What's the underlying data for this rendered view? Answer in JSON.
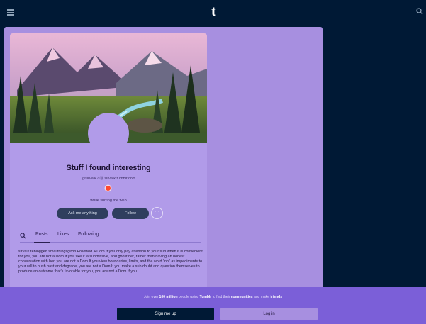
{
  "topbar": {
    "logo": "t"
  },
  "blog": {
    "title": "Stuff I found interesting",
    "handle": "@sirvalk / Ⓜ sirvalk.tumblr.com",
    "description": "while surfing the web"
  },
  "actions": {
    "ask": "Ask me anything",
    "follow": "Follow",
    "more": "⋯"
  },
  "tabs": {
    "posts": "Posts",
    "likes": "Likes",
    "following": "Following"
  },
  "post": {
    "text": "sirvalk reblogged smallthingsgiron Followed A Dom.If you only pay attention to your sub when it is convenient for you, you are not a Dom.If you 'like it' a submissive, and ghost her, rather than having an honest conversation with her, you are not a Dom.If you view boundaries, limits, and the word \"no\" as impediments to your will to push past and degrade, you are not a Dom.If you make a sub doubt and question themselves to produce an outcome that's favorable for you, you are not a Dom.If you"
  },
  "banner": {
    "pre": "Join over ",
    "count": "100 million",
    "mid1": " people using ",
    "brand": "Tumblr",
    "mid2": " to find their ",
    "communities": "communities",
    "mid3": " and make ",
    "friends": "friends",
    "signup": "Sign me up",
    "login": "Log in"
  },
  "colors": {
    "accent": "#7b5fd8",
    "panel": "#a78fe0",
    "navy": "#001935",
    "dot": "#ff4930"
  }
}
